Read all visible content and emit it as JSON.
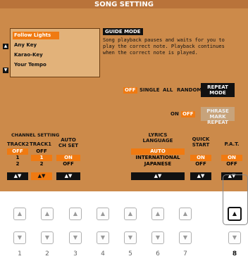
{
  "title": "SONG SETTING",
  "list": {
    "items": [
      "Follow Lights",
      "Any Key",
      "Karao-Key",
      "Your Tempo"
    ],
    "selected_index": 0
  },
  "guide": {
    "header": "GUIDE MODE",
    "description": "Song playback pauses and waits for you to play the correct note. Playback continues when the correct note is played."
  },
  "repeat": {
    "modes": [
      "OFF",
      "SINGLE",
      "ALL",
      "RANDOM"
    ],
    "selected": "OFF",
    "button_line1": "REPEAT",
    "button_line2": "MODE"
  },
  "phrase": {
    "on": "ON",
    "off": "OFF",
    "selected": "OFF",
    "button_line1": "PHRASE MARK",
    "button_line2": "REPEAT"
  },
  "channel": {
    "section_label": "CHANNEL SETTING",
    "track2": {
      "label": "TRACK2",
      "values": [
        "OFF",
        "1",
        "2"
      ],
      "selected": "OFF"
    },
    "track1": {
      "label": "TRACK1",
      "values": [
        "OFF",
        "1",
        "2"
      ],
      "selected": "1"
    },
    "auto_ch_set": {
      "label_line1": "AUTO",
      "label_line2": "CH SET",
      "values": [
        "ON",
        "OFF"
      ],
      "selected": "ON"
    }
  },
  "lyrics": {
    "label_line1": "LYRICS",
    "label_line2": "LANGUAGE",
    "values": [
      "AUTO",
      "INTERNATIONAL",
      "JAPANESE"
    ],
    "selected": "AUTO"
  },
  "quick_start": {
    "label_line1": "QUICK",
    "label_line2": "START",
    "values": [
      "ON",
      "OFF"
    ],
    "selected": "ON"
  },
  "pat": {
    "label": "P.A.T.",
    "values": [
      "ON",
      "OFF"
    ],
    "selected": "ON"
  },
  "buttons": {
    "numbers": [
      "1",
      "2",
      "3",
      "4",
      "5",
      "6",
      "7",
      "8"
    ],
    "active_index": 7
  },
  "colors": {
    "lcd_bg": "#cc8a4a",
    "highlight": "#f07a11",
    "dark": "#111111"
  }
}
